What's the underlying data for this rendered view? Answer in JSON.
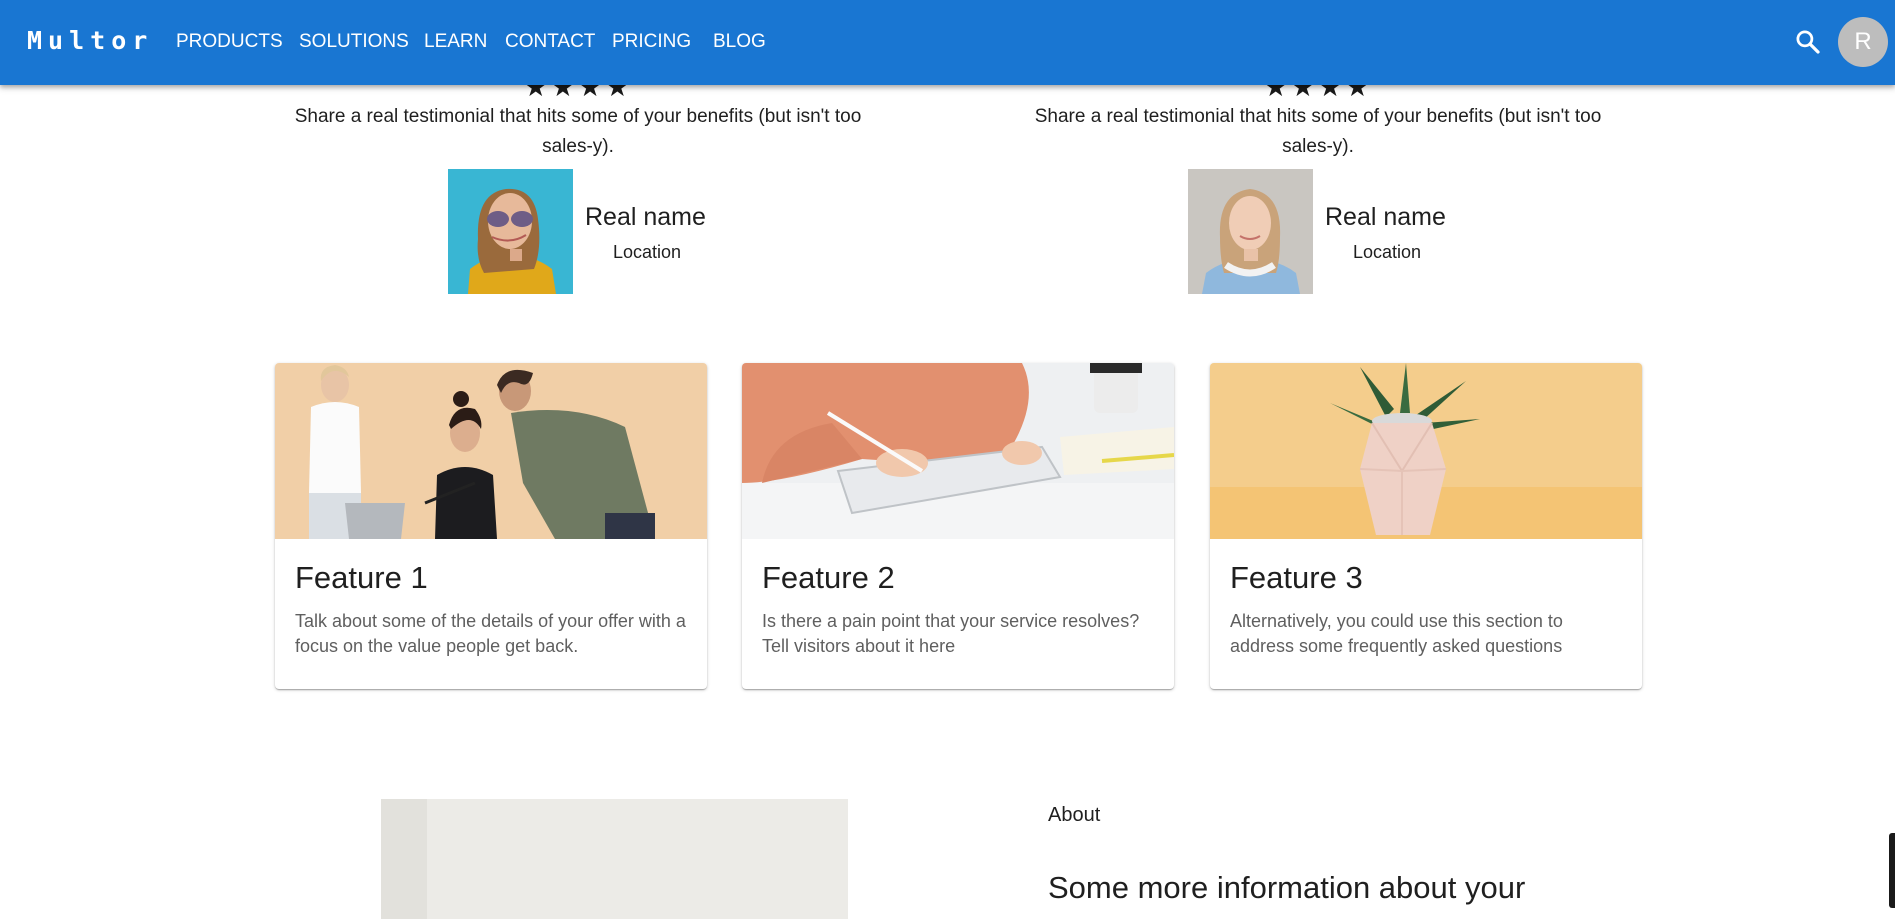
{
  "header": {
    "logo": "Multor",
    "nav": [
      {
        "label": "PRODUCTS"
      },
      {
        "label": "SOLUTIONS"
      },
      {
        "label": "LEARN"
      },
      {
        "label": "CONTACT"
      },
      {
        "label": "PRICING"
      },
      {
        "label": "BLOG"
      }
    ],
    "search_icon": "search-icon",
    "avatar_initial": "R"
  },
  "testimonials": [
    {
      "stars": "★★★★",
      "rating": 4,
      "quote": "Share a real testimonial that hits some of your benefits (but isn't too sales-y).",
      "name": "Real name",
      "location": "Location"
    },
    {
      "stars": "★★★★",
      "rating": 4,
      "quote": "Share a real testimonial that hits some of your benefits (but isn't too sales-y).",
      "name": "Real name",
      "location": "Location"
    }
  ],
  "features": [
    {
      "title": "Feature 1",
      "text": "Talk about some of the details of your offer with a focus on the value people get back."
    },
    {
      "title": "Feature 2",
      "text": "Is there a pain point that your service resolves? Tell visitors about it here"
    },
    {
      "title": "Feature 3",
      "text": "Alternatively, you could use this section to address some frequently asked questions"
    }
  ],
  "about": {
    "label": "About",
    "heading": "Some more information about your"
  },
  "colors": {
    "appbar": "#1976d2",
    "avatar": "#bdbdbd",
    "body_text": "#1f1f1f",
    "secondary_text": "#5f5f5f"
  }
}
